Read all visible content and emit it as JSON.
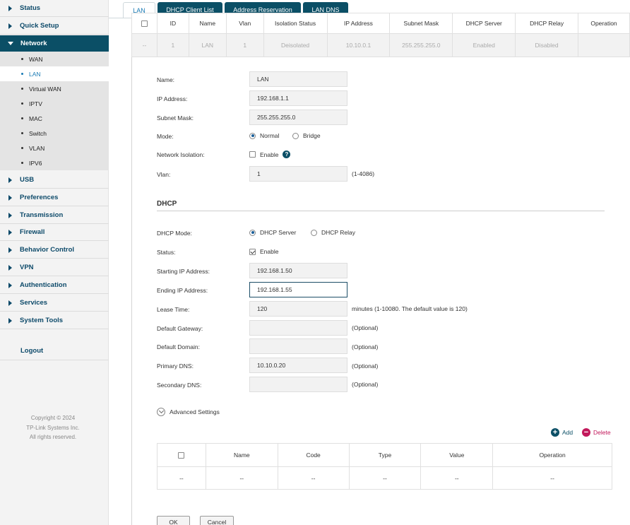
{
  "sidebar": {
    "menu": [
      {
        "label": "Status"
      },
      {
        "label": "Quick Setup"
      },
      {
        "label": "Network"
      },
      {
        "label": "USB"
      },
      {
        "label": "Preferences"
      },
      {
        "label": "Transmission"
      },
      {
        "label": "Firewall"
      },
      {
        "label": "Behavior Control"
      },
      {
        "label": "VPN"
      },
      {
        "label": "Authentication"
      },
      {
        "label": "Services"
      },
      {
        "label": "System Tools"
      }
    ],
    "network_sub": [
      {
        "label": "WAN"
      },
      {
        "label": "LAN"
      },
      {
        "label": "Virtual WAN"
      },
      {
        "label": "IPTV"
      },
      {
        "label": "MAC"
      },
      {
        "label": "Switch"
      },
      {
        "label": "VLAN"
      },
      {
        "label": "IPV6"
      }
    ],
    "logout": "Logout",
    "copyright": [
      "Copyright  © 2024",
      "TP-Link Systems Inc.",
      "All rights reserved."
    ]
  },
  "tabs": [
    {
      "label": "LAN"
    },
    {
      "label": "DHCP Client List"
    },
    {
      "label": "Address Reservation"
    },
    {
      "label": "LAN DNS"
    }
  ],
  "vlan_table": {
    "headers": [
      "ID",
      "Name",
      "Vlan",
      "Isolation Status",
      "IP Address",
      "Subnet Mask",
      "DHCP Server",
      "DHCP Relay",
      "Operation"
    ],
    "row": [
      "--",
      "1",
      "LAN",
      "1",
      "Deisolated",
      "10.10.0.1",
      "255.255.255.0",
      "Enabled",
      "Disabled",
      ""
    ]
  },
  "form": {
    "name": {
      "label": "Name:",
      "value": "LAN"
    },
    "ip": {
      "label": "IP Address:",
      "value": "192.168.1.1"
    },
    "mask": {
      "label": "Subnet Mask:",
      "value": "255.255.255.0"
    },
    "mode": {
      "label": "Mode:",
      "opt1": "Normal",
      "opt2": "Bridge",
      "selected": "Normal"
    },
    "isolation": {
      "label": "Network Isolation:",
      "opt": "Enable",
      "help": "?"
    },
    "vlan": {
      "label": "Vlan:",
      "value": "1",
      "hint": "(1-4086)"
    }
  },
  "dhcp": {
    "title": "DHCP",
    "mode": {
      "label": "DHCP Mode:",
      "opt1": "DHCP Server",
      "opt2": "DHCP Relay",
      "selected": "DHCP Server"
    },
    "status": {
      "label": "Status:",
      "opt": "Enable"
    },
    "start": {
      "label": "Starting IP Address:",
      "value": "192.168.1.50"
    },
    "end": {
      "label": "Ending IP Address:",
      "value": "192.168.1.55"
    },
    "lease": {
      "label": "Lease Time:",
      "value": "120",
      "hint": "minutes (1-10080. The default value is 120)"
    },
    "gateway": {
      "label": "Default Gateway:",
      "value": "",
      "hint": "(Optional)"
    },
    "domain": {
      "label": "Default Domain:",
      "value": "",
      "hint": "(Optional)"
    },
    "dns1": {
      "label": "Primary DNS:",
      "value": "10.10.0.20",
      "hint": "(Optional)"
    },
    "dns2": {
      "label": "Secondary DNS:",
      "value": "",
      "hint": "(Optional)"
    }
  },
  "advanced": {
    "label": "Advanced Settings",
    "add": "Add",
    "delete": "Delete"
  },
  "option_table": {
    "headers": [
      "Name",
      "Code",
      "Type",
      "Value",
      "Operation"
    ],
    "row": [
      "--",
      "--",
      "--",
      "--",
      "--",
      "--"
    ]
  },
  "buttons": {
    "ok": "OK",
    "cancel": "Cancel"
  }
}
